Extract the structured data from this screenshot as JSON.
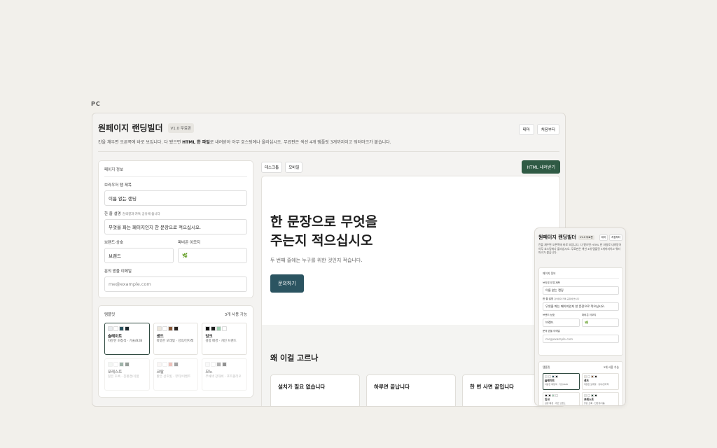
{
  "page_label": "PC",
  "app": {
    "title": "원페이지 랜딩빌더",
    "version": "V1.0 무료판",
    "buttons": {
      "theme": "테마",
      "reset": "처음부터"
    },
    "description_parts": [
      "칸을 채우면 오른쪽에 바로 보입니다. 다 됐으면 ",
      "HTML 한 파일",
      "로 내려받아 아무 호스팅에나 올리십시오. 무료판은 섹션 4개 템플릿 3개까지이고 워터마크가 붙습니다."
    ]
  },
  "info_panel": {
    "title": "페이지 정보",
    "tab_title_label": "브라우저 탭 제목",
    "tab_title_value": "이름 없는 랜딩",
    "summary_label": "한 줄 설명",
    "summary_hint": "검색결과·카톡 공유에 씁니다",
    "summary_value": "무엇을 파는 페이지인지 한 문장으로 적으십시오.",
    "brand_label": "브랜드·상호",
    "brand_value": "브랜드",
    "favicon_label": "파비콘 이모지",
    "favicon_value": "🌿",
    "email_label": "문의 받을 이메일",
    "email_placeholder": "me@example.com"
  },
  "template_panel": {
    "title": "템플릿",
    "available": "3개 사용 가능",
    "templates": [
      {
        "name": "슬레이트",
        "desc": "차분한 회청색 · 기술/B2B",
        "colors": [
          "#e8ecef",
          "#ffffff",
          "#2b5461",
          "#1e2a30"
        ],
        "selected": true,
        "locked": false
      },
      {
        "name": "샌드",
        "desc": "따뜻한 모래빛 · 강의/전자책",
        "colors": [
          "#eee8de",
          "#ffffff",
          "#8a5a3a",
          "#2a2420"
        ],
        "selected": false,
        "locked": false
      },
      {
        "name": "잉크",
        "desc": "검정 배경 · 개인 브랜드",
        "colors": [
          "#111111",
          "#1f1f1f",
          "#9ecfb0",
          "#ffffff"
        ],
        "selected": false,
        "locked": false
      },
      {
        "name": "포레스트",
        "desc": "짙은 초록 · 친환경/식품",
        "colors": [
          "#e6ece6",
          "#ffffff",
          "#2f5a44",
          "#1a2a20"
        ],
        "selected": false,
        "locked": true
      },
      {
        "name": "코랄",
        "desc": "밝은 산호빛 · 뷰티/이벤트",
        "colors": [
          "#f6ecea",
          "#ffffff",
          "#d9776a",
          "#333333"
        ],
        "selected": false,
        "locked": true
      },
      {
        "name": "모노",
        "desc": "무채색 강대비 · 포트폴리오",
        "colors": [
          "#f2f2f2",
          "#ffffff",
          "#555555",
          "#111111"
        ],
        "selected": false,
        "locked": true
      }
    ]
  },
  "preview": {
    "tabs": [
      "데스크톱",
      "모바일"
    ],
    "download_label": "HTML 내려받기",
    "hero_title_lines": [
      "한 문장으로 무엇을",
      "주는지 적으십시오"
    ],
    "hero_subtitle": "두 번째 줄에는 누구를 위한 것인지 적습니다.",
    "hero_cta": "문의하기",
    "why_title": "왜 이걸 고르나",
    "cards": [
      "설치가 필요 없습니다",
      "하루면 끝납니다",
      "한 번 사면 끝입니다"
    ]
  },
  "mobile": {
    "title": "원페이지 랜딩빌더",
    "version": "V1.0 무료판",
    "buttons": [
      "테마",
      "처음부터"
    ],
    "description": "칸을 채우면 오른쪽에 바로 보입니다. 다 됐으면 HTML 한 파일로 내려받아 아무 호스팅에나 올리십시오. 무료판은 섹션 4개 템플릿 3개까지이고 워터마크가 붙습니다."
  },
  "colors": {
    "accent": "#2f5a44",
    "cta": "#2b5461",
    "background": "#f2f0eb"
  }
}
